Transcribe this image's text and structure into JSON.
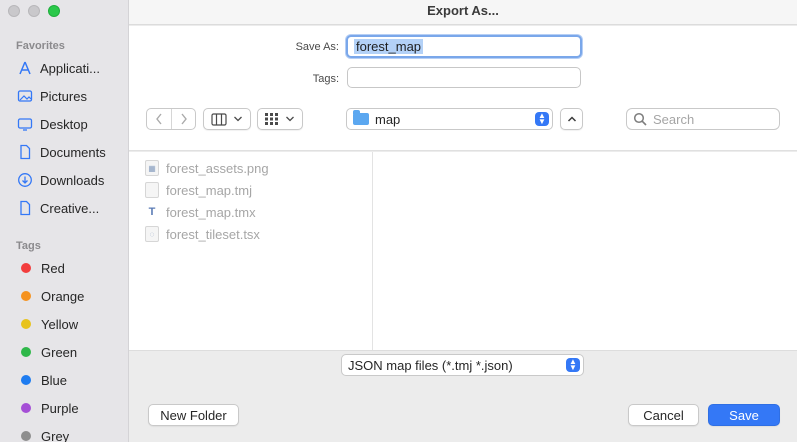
{
  "window": {
    "title": "Export As..."
  },
  "sidebar": {
    "favorites_heading": "Favorites",
    "favorites": [
      {
        "label": "Applicati...",
        "icon": "applications-icon"
      },
      {
        "label": "Pictures",
        "icon": "pictures-icon"
      },
      {
        "label": "Desktop",
        "icon": "desktop-icon"
      },
      {
        "label": "Documents",
        "icon": "document-icon"
      },
      {
        "label": "Downloads",
        "icon": "downloads-icon"
      },
      {
        "label": "Creative...",
        "icon": "document-icon"
      }
    ],
    "tags_heading": "Tags",
    "tags": [
      {
        "label": "Red",
        "color": "#f23d3d"
      },
      {
        "label": "Orange",
        "color": "#f5921f"
      },
      {
        "label": "Yellow",
        "color": "#e8c31b"
      },
      {
        "label": "Green",
        "color": "#2fb84a"
      },
      {
        "label": "Blue",
        "color": "#1e7cf0"
      },
      {
        "label": "Purple",
        "color": "#a54fd6"
      },
      {
        "label": "Grey",
        "color": "#8e8e8e"
      }
    ]
  },
  "form": {
    "save_as_label": "Save As:",
    "save_as_value": "forest_map",
    "tags_label": "Tags:",
    "tags_value": ""
  },
  "toolbar": {
    "location": "map",
    "search_placeholder": "Search"
  },
  "files": [
    {
      "name": "forest_assets.png",
      "icon": "image-file-icon"
    },
    {
      "name": "forest_map.tmj",
      "icon": "file-icon"
    },
    {
      "name": "forest_map.tmx",
      "icon": "tmx-file-icon"
    },
    {
      "name": "forest_tileset.tsx",
      "icon": "tsx-file-icon"
    }
  ],
  "format": {
    "selected": "JSON map files (*.tmj *.json)"
  },
  "buttons": {
    "new_folder": "New Folder",
    "cancel": "Cancel",
    "save": "Save"
  },
  "colors": {
    "accent": "#3478f6"
  }
}
